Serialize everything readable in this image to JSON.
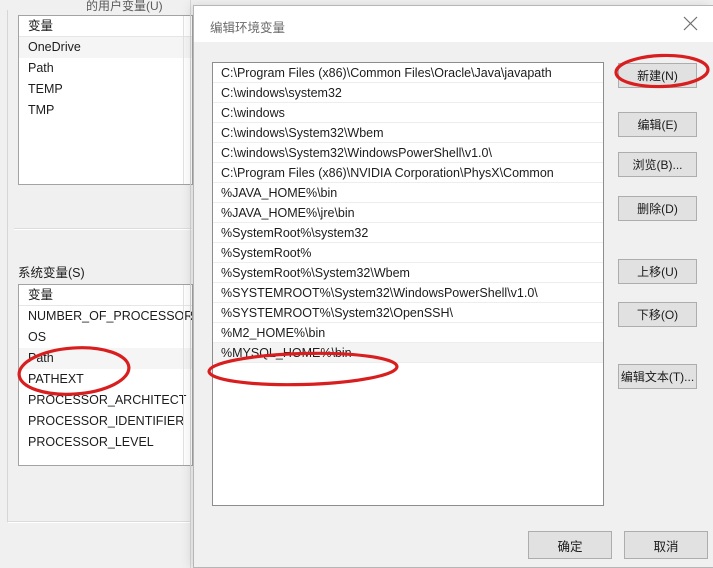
{
  "background_window": {
    "cut_top_label": "的用户变量(U)",
    "user_vars": {
      "header": "变量",
      "items": [
        "OneDrive",
        "Path",
        "TEMP",
        "TMP"
      ]
    },
    "system_vars": {
      "label": "系统变量(S)",
      "header": "变量",
      "items": [
        "NUMBER_OF_PROCESSORS",
        "OS",
        "Path",
        "PATHEXT",
        "PROCESSOR_ARCHITECT",
        "PROCESSOR_IDENTIFIER",
        "PROCESSOR_LEVEL"
      ]
    }
  },
  "dialog": {
    "title": "编辑环境变量",
    "close_icon": "close-icon",
    "path_entries": [
      "C:\\Program Files (x86)\\Common Files\\Oracle\\Java\\javapath",
      "C:\\windows\\system32",
      "C:\\windows",
      "C:\\windows\\System32\\Wbem",
      "C:\\windows\\System32\\WindowsPowerShell\\v1.0\\",
      "C:\\Program Files (x86)\\NVIDIA Corporation\\PhysX\\Common",
      "%JAVA_HOME%\\bin",
      "%JAVA_HOME%\\jre\\bin",
      "%SystemRoot%\\system32",
      "%SystemRoot%",
      "%SystemRoot%\\System32\\Wbem",
      "%SYSTEMROOT%\\System32\\WindowsPowerShell\\v1.0\\",
      "%SYSTEMROOT%\\System32\\OpenSSH\\",
      "%M2_HOME%\\bin",
      "%MYSQL_HOME%\\bin"
    ],
    "side_buttons": [
      {
        "label": "新建(N)",
        "name": "new-button"
      },
      {
        "label": "编辑(E)",
        "name": "edit-button"
      },
      {
        "label": "浏览(B)...",
        "name": "browse-button"
      },
      {
        "label": "删除(D)",
        "name": "delete-button"
      },
      {
        "label": "上移(U)",
        "name": "move-up-button"
      },
      {
        "label": "下移(O)",
        "name": "move-down-button"
      },
      {
        "label": "编辑文本(T)...",
        "name": "edit-text-button"
      }
    ],
    "ok_label": "确定",
    "cancel_label": "取消"
  },
  "annotations": {
    "accent_color": "#d81e1e",
    "marks": [
      {
        "name": "annotation-ellipse-system-path",
        "target": "Path"
      },
      {
        "name": "annotation-ellipse-mysql-home",
        "target": "%MYSQL_HOME%\\bin"
      },
      {
        "name": "annotation-ellipse-new-button",
        "target": "新建(N)"
      }
    ]
  }
}
